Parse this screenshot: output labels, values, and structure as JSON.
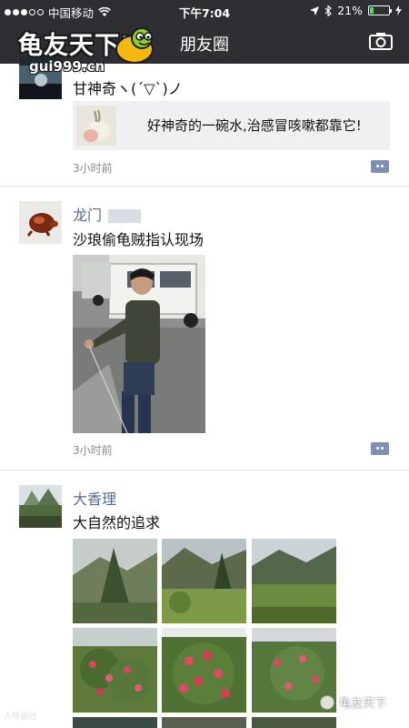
{
  "status_bar": {
    "carrier": "中国移动",
    "time": "下午7:04",
    "battery": "21%",
    "battery_level": 0.21
  },
  "nav": {
    "title": "朋友圈",
    "back_icon": "back-chevron-icon",
    "camera_icon": "camera-icon"
  },
  "logo": {
    "title": "龟友天下!",
    "url": "gui999.cn"
  },
  "posts": [
    {
      "name_partial": "…",
      "text": "甘神奇ヽ(ˊ▽ˋ)ノ",
      "share_title": "好神奇的一碗水,治感冒咳嗽都靠它!",
      "time": "3小时前"
    },
    {
      "name": "龙门",
      "text": "沙琅偷龟贼指认现场",
      "time": "3小时前"
    },
    {
      "name": "大香理",
      "text": "大自然的追求"
    }
  ],
  "watermarks": {
    "right": "龟友天下",
    "left": "大熊原创"
  },
  "colors": {
    "bar": "#2f2f33",
    "name": "#576b95",
    "battery": "#4cd964"
  }
}
